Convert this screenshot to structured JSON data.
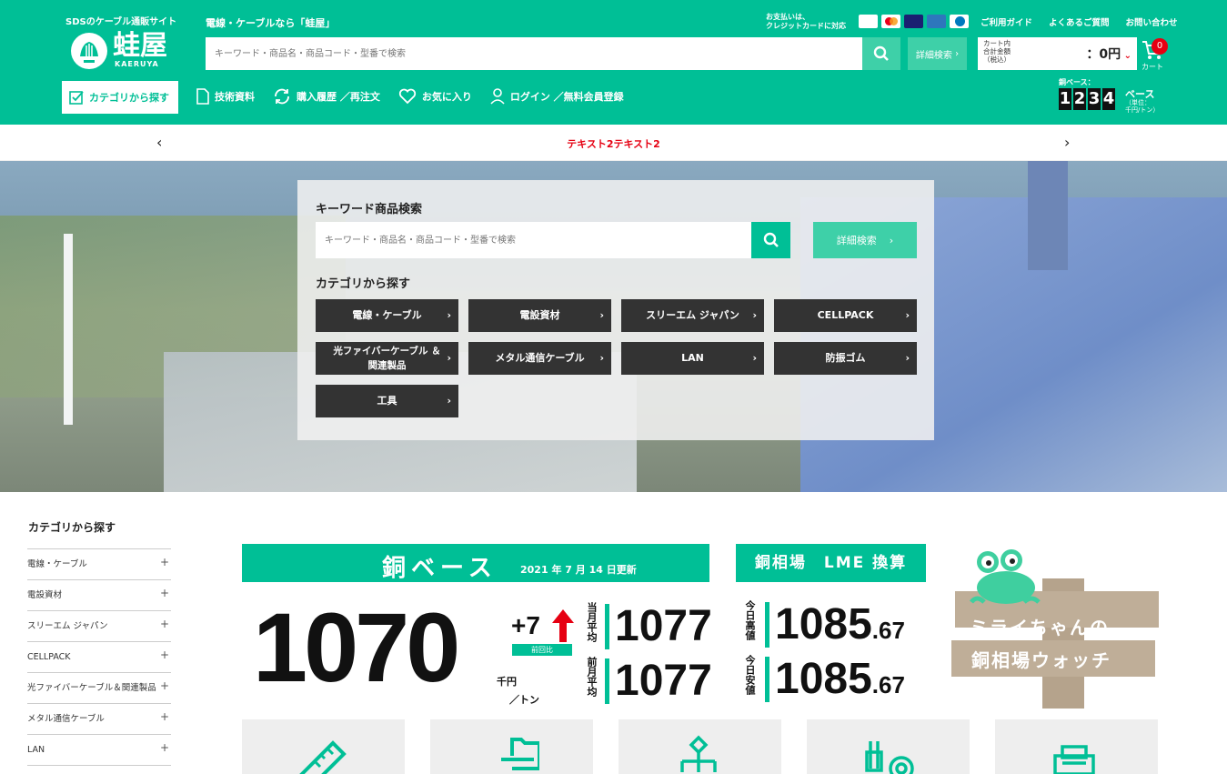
{
  "header": {
    "logo_tag": "SDSのケーブル通販サイト",
    "logo_name": "蛙屋",
    "logo_sub": "KAERUYA",
    "tagline": "電線・ケーブルなら「蛙屋」",
    "search_placeholder": "キーワード・商品名・商品コード・型番で検索",
    "detail_search": "詳細検索",
    "payment_label_1": "お支払いは、",
    "payment_label_2": "クレジットカードに対応",
    "links": [
      "ご利用ガイド",
      "よくあるご質問",
      "お問い合わせ"
    ],
    "cart": {
      "label_1": "カート内",
      "label_2": "合計金額",
      "label_3": "（税込）",
      "amount": "：0円",
      "count": "0",
      "caption": "カート"
    },
    "nav_category": "カテゴリから探す",
    "nav": [
      "技術資料",
      "購入履歴 ／再注文",
      "お気に入り",
      "ログイン ／無料会員登録"
    ],
    "copper": {
      "label": "銅ベース：",
      "digits": [
        "1",
        "2",
        "3",
        "4"
      ],
      "base": "ベース",
      "unit_1": "（単位：",
      "unit_2": "千円/トン）"
    }
  },
  "notice": {
    "text": "テキスト2テキスト2"
  },
  "hero_panel": {
    "keyword_title": "キーワード商品検索",
    "search_placeholder": "キーワード・商品名・商品コード・型番で検索",
    "detail_search": "詳細検索",
    "category_title": "カテゴリから探す",
    "categories": [
      "電線・ケーブル",
      "電設資材",
      "スリーエム ジャパン",
      "CELLPACK",
      "光ファイバーケーブル ＆関連製品",
      "メタル通信ケーブル",
      "LAN",
      "防振ゴム",
      "工具"
    ]
  },
  "sidebar": {
    "title": "カテゴリから探す",
    "items": [
      "電線・ケーブル",
      "電設資材",
      "スリーエム ジャパン",
      "CELLPACK",
      "光ファイバーケーブル＆関連製品",
      "メタル通信ケーブル",
      "LAN"
    ]
  },
  "copper_base": {
    "title": "銅ベース",
    "updated": "2021 年 7 月 14 日更新",
    "value": "1070",
    "delta": "+7",
    "delta_label": "前回比",
    "unit_1": "千円",
    "unit_2": "／トン",
    "this_month_label": "当月平均",
    "this_month": "1077",
    "last_month_label": "前月平均",
    "last_month": "1077"
  },
  "lme": {
    "title": "銅相場　LME 換算",
    "high_label": "今日高値",
    "high_int": "1085",
    "high_dec": ".67",
    "low_label": "今日安値",
    "low_int": "1085",
    "low_dec": ".67"
  },
  "mirai": {
    "line_1": "ミライちゃんの",
    "line_2": "銅相場ウォッチ"
  },
  "colors": {
    "brand": "#00bf96",
    "accent_red": "#e60012",
    "dark_button": "#333333"
  }
}
